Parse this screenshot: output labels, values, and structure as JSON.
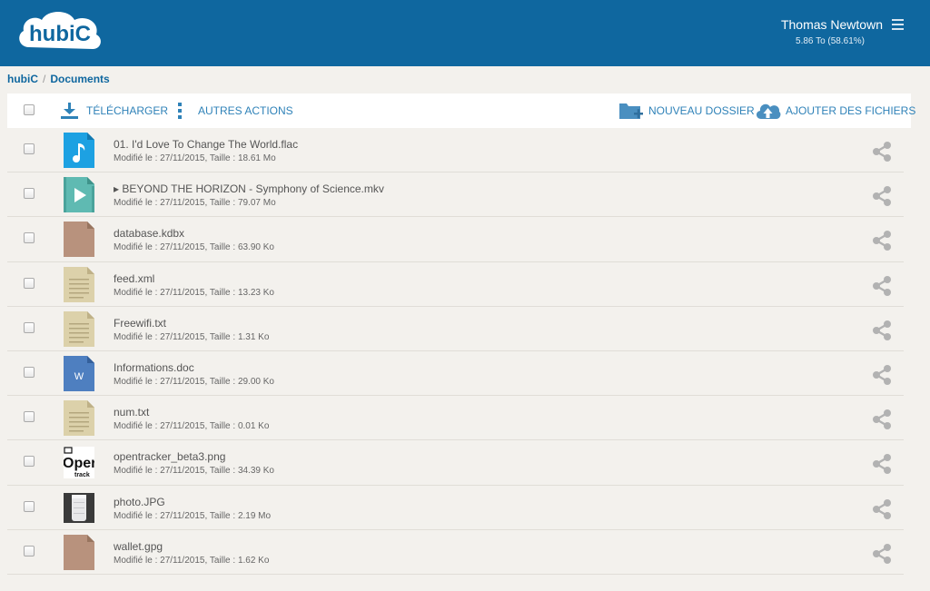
{
  "header": {
    "logo_text": "hubiC",
    "user_name": "Thomas Newtown",
    "quota": "5.86 To (58.61%)"
  },
  "breadcrumb": {
    "root": "hubiC",
    "separator": "/",
    "current": "Documents"
  },
  "toolbar": {
    "download_label": "TÉLÉCHARGER",
    "more_actions_label": "AUTRES ACTIONS",
    "new_folder_label": "NOUVEAU DOSSIER",
    "add_files_label": "AJOUTER DES FICHIERS"
  },
  "colors": {
    "header_bg": "#0f679f",
    "accent": "#2f82b8"
  },
  "files": [
    {
      "name": "01. I'd Love To Change The World.flac",
      "meta": "Modifié le  : 27/11/2015, Taille  : 18.61 Mo",
      "icon": "audio-file-icon"
    },
    {
      "name": "▸ BEYOND THE HORIZON - Symphony of Science.mkv",
      "meta": "Modifié le  : 27/11/2015, Taille  : 79.07 Mo",
      "icon": "video-file-icon"
    },
    {
      "name": "database.kdbx",
      "meta": "Modifié le  : 27/11/2015, Taille  : 63.90 Ko",
      "icon": "generic-file-icon"
    },
    {
      "name": "feed.xml",
      "meta": "Modifié le  : 27/11/2015, Taille  : 13.23 Ko",
      "icon": "text-file-icon"
    },
    {
      "name": "Freewifi.txt",
      "meta": "Modifié le  : 27/11/2015, Taille  : 1.31 Ko",
      "icon": "text-file-icon"
    },
    {
      "name": "Informations.doc",
      "meta": "Modifié le  : 27/11/2015, Taille  : 29.00 Ko",
      "icon": "word-file-icon",
      "icon_letter": "W"
    },
    {
      "name": "num.txt",
      "meta": "Modifié le  : 27/11/2015, Taille  : 0.01 Ko",
      "icon": "text-file-icon"
    },
    {
      "name": "opentracker_beta3.png",
      "meta": "Modifié le  : 27/11/2015, Taille  : 34.39 Ko",
      "icon": "image-thumbnail-icon",
      "thumb_text": "Oper",
      "thumb_subtext": "track"
    },
    {
      "name": "photo.JPG",
      "meta": "Modifié le  : 27/11/2015, Taille  : 2.19 Mo",
      "icon": "photo-thumbnail-icon"
    },
    {
      "name": "wallet.gpg",
      "meta": "Modifié le  : 27/11/2015, Taille  : 1.62 Ko",
      "icon": "generic-file-icon"
    }
  ]
}
